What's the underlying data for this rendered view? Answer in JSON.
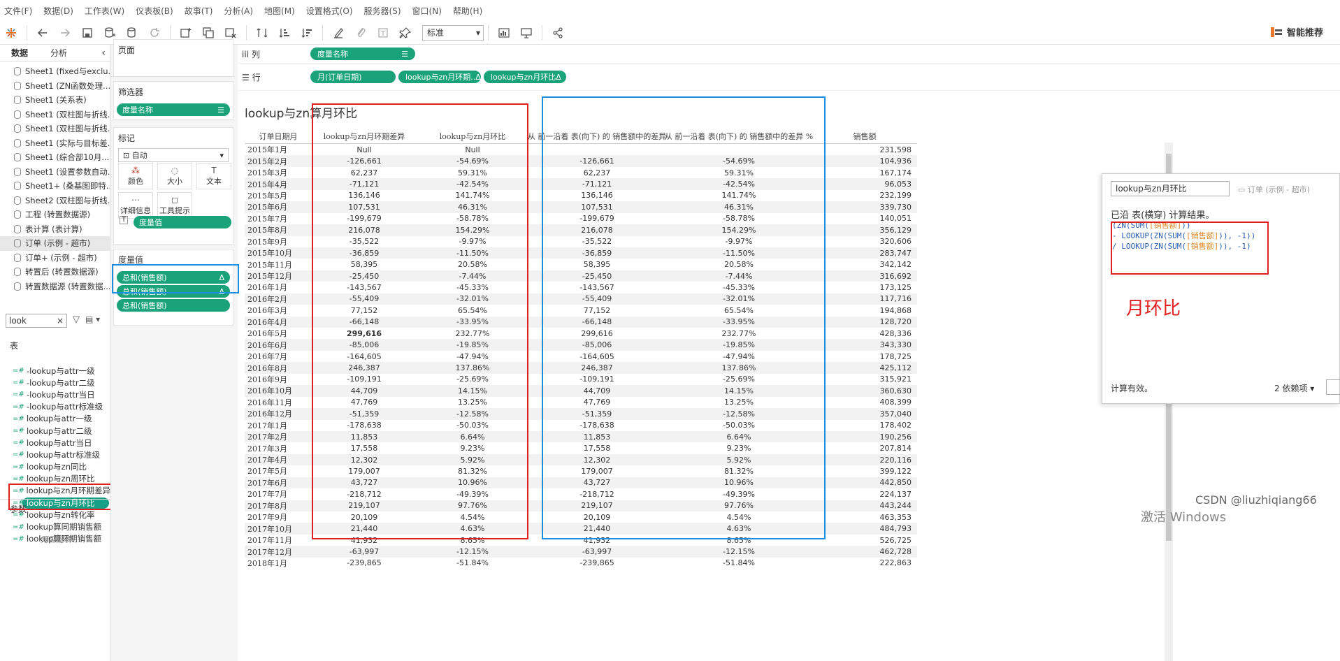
{
  "menu": [
    "文件(F)",
    "数据(D)",
    "工作表(W)",
    "仪表板(B)",
    "故事(T)",
    "分析(A)",
    "地图(M)",
    "设置格式(O)",
    "服务器(S)",
    "窗口(N)",
    "帮助(H)"
  ],
  "toolbar": {
    "fit_select": "标准",
    "smart_label": "智能推荐",
    "colors": {
      "accent": "#1aa37a",
      "red_box": "#e02020",
      "blue_box": "#1a8fe0"
    }
  },
  "leftpane": {
    "tab_data": "数据",
    "tab_analysis": "分析",
    "datasources": [
      "Sheet1 (fixed与exclu...",
      "Sheet1 (ZN函数处理...",
      "Sheet1 (关系表)",
      "Sheet1 (双柱图与折线...",
      "Sheet1 (双柱图与折线...",
      "Sheet1 (实际与目标差...",
      "Sheet1 (综合部10月...",
      "Sheet1 (设置参数自动...",
      "Sheet1+ (桑基图即特...",
      "Sheet2 (双柱图与折线...",
      "工程 (转置数据源)",
      "表计算 (表计算)",
      "订单 (示例 - 超市)",
      "订单+ (示例 - 超市)",
      "转置后 (转置数据源)",
      "转置数据源 (转置数据..."
    ],
    "search_value": "look",
    "table_header": "表",
    "fields": [
      "-lookup与attr一级",
      "-lookup与attr二级",
      "-lookup与attr当日",
      "-lookup与attr标准级",
      "lookup与attr一级",
      "lookup与attr二级",
      "lookup与attr当日",
      "lookup与attr标准级",
      "lookup与zn同比",
      "lookup与zn周环比",
      "lookup与zn月环期差异",
      "lookup与zn月环比",
      "lookup与zn转化率",
      "lookup算同期销售额",
      "lookup算环期销售额"
    ],
    "params_header": "参数",
    "params_empty": "无匹配项"
  },
  "shelfcol": {
    "pages": "页面",
    "filters": "筛选器",
    "filter_pill": "度量名称",
    "marks": "标记",
    "mark_type": "自动",
    "mark_buttons": [
      "颜色",
      "大小",
      "文本",
      "详细信息",
      "工具提示"
    ],
    "mark_pill": "度量值",
    "measure_values": "度量值",
    "mv_pills": [
      "总和(销售额)",
      "总和(销售额)",
      "总和(销售额)"
    ]
  },
  "shelves": {
    "columns_label": "列",
    "rows_label": "行",
    "columns_pill": "度量名称",
    "rows_pills": [
      "月(订单日期)",
      "lookup与zn月环期..",
      "lookup与zn月环比"
    ]
  },
  "view": {
    "title": "lookup与zn算月环比",
    "headers": [
      "订单日期月",
      "lookup与zn月环期差异",
      "lookup与zn月环比",
      "从 前一沿着 表(向下) 的 销售额中的差异",
      "从 前一沿着 表(向下) 的 销售额中的差异 %",
      "销售额"
    ],
    "rows": [
      [
        "2015年1月",
        "Null",
        "Null",
        "",
        "",
        "231,598"
      ],
      [
        "2015年2月",
        "-126,661",
        "-54.69%",
        "-126,661",
        "-54.69%",
        "104,936"
      ],
      [
        "2015年3月",
        "62,237",
        "59.31%",
        "62,237",
        "59.31%",
        "167,174"
      ],
      [
        "2015年4月",
        "-71,121",
        "-42.54%",
        "-71,121",
        "-42.54%",
        "96,053"
      ],
      [
        "2015年5月",
        "136,146",
        "141.74%",
        "136,146",
        "141.74%",
        "232,199"
      ],
      [
        "2015年6月",
        "107,531",
        "46.31%",
        "107,531",
        "46.31%",
        "339,730"
      ],
      [
        "2015年7月",
        "-199,679",
        "-58.78%",
        "-199,679",
        "-58.78%",
        "140,051"
      ],
      [
        "2015年8月",
        "216,078",
        "154.29%",
        "216,078",
        "154.29%",
        "356,129"
      ],
      [
        "2015年9月",
        "-35,522",
        "-9.97%",
        "-35,522",
        "-9.97%",
        "320,606"
      ],
      [
        "2015年10月",
        "-36,859",
        "-11.50%",
        "-36,859",
        "-11.50%",
        "283,747"
      ],
      [
        "2015年11月",
        "58,395",
        "20.58%",
        "58,395",
        "20.58%",
        "342,142"
      ],
      [
        "2015年12月",
        "-25,450",
        "-7.44%",
        "-25,450",
        "-7.44%",
        "316,692"
      ],
      [
        "2016年1月",
        "-143,567",
        "-45.33%",
        "-143,567",
        "-45.33%",
        "173,125"
      ],
      [
        "2016年2月",
        "-55,409",
        "-32.01%",
        "-55,409",
        "-32.01%",
        "117,716"
      ],
      [
        "2016年3月",
        "77,152",
        "65.54%",
        "77,152",
        "65.54%",
        "194,868"
      ],
      [
        "2016年4月",
        "-66,148",
        "-33.95%",
        "-66,148",
        "-33.95%",
        "128,720"
      ],
      [
        "2016年5月",
        "299,616",
        "232.77%",
        "299,616",
        "232.77%",
        "428,336"
      ],
      [
        "2016年6月",
        "-85,006",
        "-19.85%",
        "-85,006",
        "-19.85%",
        "343,330"
      ],
      [
        "2016年7月",
        "-164,605",
        "-47.94%",
        "-164,605",
        "-47.94%",
        "178,725"
      ],
      [
        "2016年8月",
        "246,387",
        "137.86%",
        "246,387",
        "137.86%",
        "425,112"
      ],
      [
        "2016年9月",
        "-109,191",
        "-25.69%",
        "-109,191",
        "-25.69%",
        "315,921"
      ],
      [
        "2016年10月",
        "44,709",
        "14.15%",
        "44,709",
        "14.15%",
        "360,630"
      ],
      [
        "2016年11月",
        "47,769",
        "13.25%",
        "47,769",
        "13.25%",
        "408,399"
      ],
      [
        "2016年12月",
        "-51,359",
        "-12.58%",
        "-51,359",
        "-12.58%",
        "357,040"
      ],
      [
        "2017年1月",
        "-178,638",
        "-50.03%",
        "-178,638",
        "-50.03%",
        "178,402"
      ],
      [
        "2017年2月",
        "11,853",
        "6.64%",
        "11,853",
        "6.64%",
        "190,256"
      ],
      [
        "2017年3月",
        "17,558",
        "9.23%",
        "17,558",
        "9.23%",
        "207,814"
      ],
      [
        "2017年4月",
        "12,302",
        "5.92%",
        "12,302",
        "5.92%",
        "220,116"
      ],
      [
        "2017年5月",
        "179,007",
        "81.32%",
        "179,007",
        "81.32%",
        "399,122"
      ],
      [
        "2017年6月",
        "43,727",
        "10.96%",
        "43,727",
        "10.96%",
        "442,850"
      ],
      [
        "2017年7月",
        "-218,712",
        "-49.39%",
        "-218,712",
        "-49.39%",
        "224,137"
      ],
      [
        "2017年8月",
        "219,107",
        "97.76%",
        "219,107",
        "97.76%",
        "443,244"
      ],
      [
        "2017年9月",
        "20,109",
        "4.54%",
        "20,109",
        "4.54%",
        "463,353"
      ],
      [
        "2017年10月",
        "21,440",
        "4.63%",
        "21,440",
        "4.63%",
        "484,793"
      ],
      [
        "2017年11月",
        "41,932",
        "8.65%",
        "41,932",
        "8.65%",
        "526,725"
      ],
      [
        "2017年12月",
        "-63,997",
        "-12.15%",
        "-63,997",
        "-12.15%",
        "462,728"
      ],
      [
        "2018年1月",
        "-239,865",
        "-51.84%",
        "-239,865",
        "-51.84%",
        "222,863"
      ]
    ]
  },
  "calc": {
    "name": "lookup与zn月环比",
    "source": "订单 (示例 - 超市)",
    "header": "已沿 表(横穿) 计算结果。",
    "formula_lines": [
      [
        "(ZN(SUM(",
        "[销售额]",
        "))"
      ],
      [
        "- LOOKUP(ZN(SUM(",
        "[销售额]",
        ")), -1))"
      ],
      [
        "/ LOOKUP(ZN(SUM(",
        "[销售额]",
        ")), -1)"
      ]
    ],
    "annotation": "月环比",
    "status": "计算有效。",
    "deps": "2 依赖项 ▾"
  },
  "watermarks": {
    "windows": "激活 Windows",
    "csdn": "CSDN @liuzhiqiang66"
  }
}
